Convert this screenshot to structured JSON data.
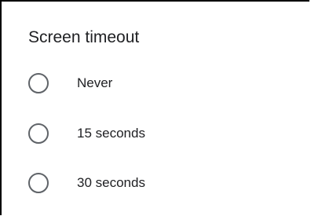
{
  "dialog": {
    "title": "Screen timeout",
    "options": [
      {
        "label": "Never",
        "selected": false
      },
      {
        "label": "15 seconds",
        "selected": false
      },
      {
        "label": "30 seconds",
        "selected": false
      }
    ]
  },
  "colors": {
    "text": "#202124",
    "radio_outline": "#5f6368",
    "background": "#ffffff"
  }
}
